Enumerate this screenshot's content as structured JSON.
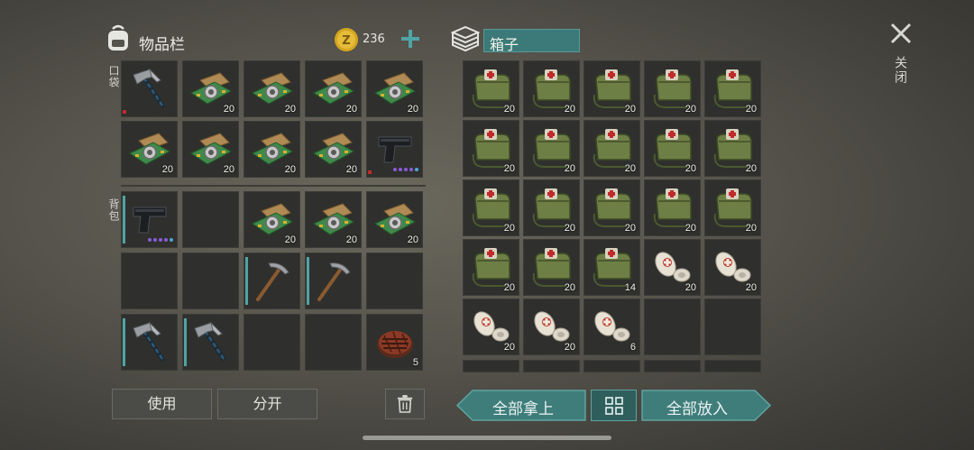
{
  "inventory": {
    "title": "物品栏",
    "coins": "236",
    "pocket_label": "口袋",
    "backpack_label": "背包",
    "use_label": "使用",
    "split_label": "分开"
  },
  "box": {
    "title": "箱子",
    "take_all_label": "全部拿上",
    "put_all_label": "全部放入"
  },
  "close_label": "关闭",
  "pocket_slots": [
    {
      "item": "hammer",
      "count": ""
    },
    {
      "item": "circuit",
      "count": "20"
    },
    {
      "item": "circuit",
      "count": "20"
    },
    {
      "item": "circuit",
      "count": "20"
    },
    {
      "item": "circuit",
      "count": "20"
    },
    {
      "item": "circuit",
      "count": "20"
    },
    {
      "item": "circuit",
      "count": "20"
    },
    {
      "item": "circuit",
      "count": "20"
    },
    {
      "item": "circuit",
      "count": "20"
    },
    {
      "item": "pistol",
      "count": ""
    }
  ],
  "backpack_slots": [
    {
      "item": "pistol",
      "count": ""
    },
    {
      "item": "empty",
      "count": ""
    },
    {
      "item": "circuit",
      "count": "20"
    },
    {
      "item": "circuit",
      "count": "20"
    },
    {
      "item": "circuit",
      "count": "20"
    },
    {
      "item": "empty",
      "count": ""
    },
    {
      "item": "empty",
      "count": ""
    },
    {
      "item": "pickaxe",
      "count": ""
    },
    {
      "item": "pickaxe",
      "count": ""
    },
    {
      "item": "empty",
      "count": ""
    },
    {
      "item": "hammer",
      "count": ""
    },
    {
      "item": "hammer",
      "count": ""
    },
    {
      "item": "empty",
      "count": ""
    },
    {
      "item": "empty",
      "count": ""
    },
    {
      "item": "steak",
      "count": "5"
    }
  ],
  "box_slots": [
    {
      "item": "medbag",
      "count": "20"
    },
    {
      "item": "medbag",
      "count": "20"
    },
    {
      "item": "medbag",
      "count": "20"
    },
    {
      "item": "medbag",
      "count": "20"
    },
    {
      "item": "medbag",
      "count": "20"
    },
    {
      "item": "medbag",
      "count": "20"
    },
    {
      "item": "medbag",
      "count": "20"
    },
    {
      "item": "medbag",
      "count": "20"
    },
    {
      "item": "medbag",
      "count": "20"
    },
    {
      "item": "medbag",
      "count": "20"
    },
    {
      "item": "medbag",
      "count": "20"
    },
    {
      "item": "medbag",
      "count": "20"
    },
    {
      "item": "medbag",
      "count": "20"
    },
    {
      "item": "medbag",
      "count": "20"
    },
    {
      "item": "medbag",
      "count": "20"
    },
    {
      "item": "medbag",
      "count": "20"
    },
    {
      "item": "medbag",
      "count": "20"
    },
    {
      "item": "medbag",
      "count": "14"
    },
    {
      "item": "bandage",
      "count": "20"
    },
    {
      "item": "bandage",
      "count": "20"
    },
    {
      "item": "bandage",
      "count": "20"
    },
    {
      "item": "bandage",
      "count": "20"
    },
    {
      "item": "bandage",
      "count": "6"
    },
    {
      "item": "empty",
      "count": ""
    },
    {
      "item": "empty",
      "count": ""
    }
  ],
  "colors": {
    "accent_teal": "#3f7d7b",
    "durability": "#4fa4a6",
    "coin_gold": "#d4a51f"
  }
}
